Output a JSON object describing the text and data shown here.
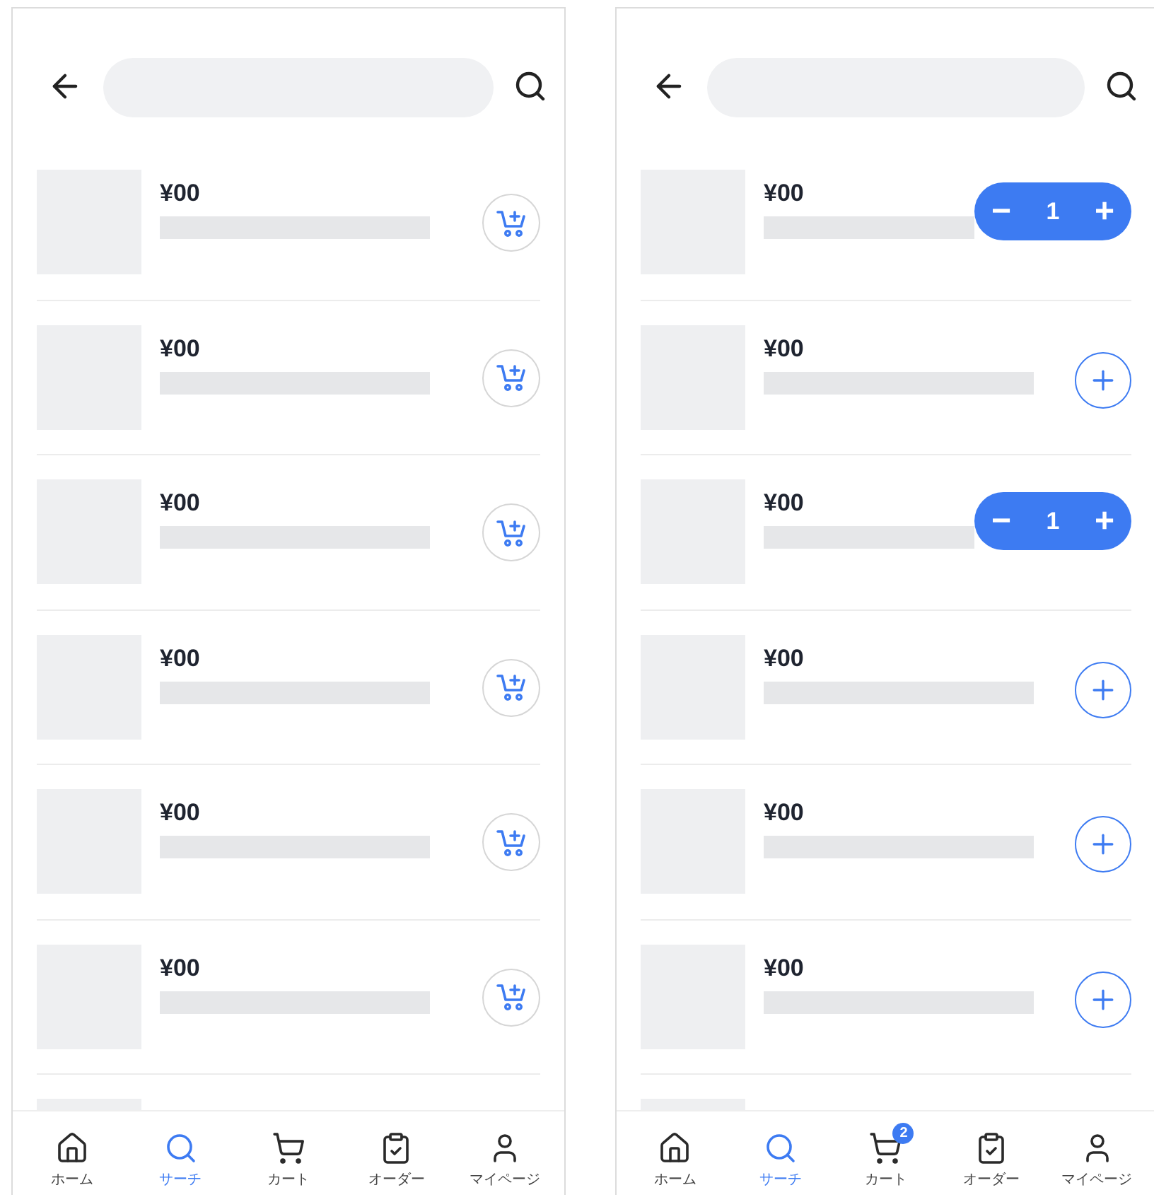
{
  "screens": [
    {
      "rows": [
        {
          "price": "¥00",
          "kind": "cart"
        },
        {
          "price": "¥00",
          "kind": "cart"
        },
        {
          "price": "¥00",
          "kind": "cart"
        },
        {
          "price": "¥00",
          "kind": "cart"
        },
        {
          "price": "¥00",
          "kind": "cart"
        },
        {
          "price": "¥00",
          "kind": "cart"
        }
      ],
      "nav": [
        {
          "label": "ホーム",
          "kind": "home",
          "selected": false
        },
        {
          "label": "サーチ",
          "kind": "search",
          "selected": true
        },
        {
          "label": "カート",
          "kind": "cart",
          "selected": false
        },
        {
          "label": "オーダー",
          "kind": "order",
          "selected": false
        },
        {
          "label": "マイページ",
          "kind": "user",
          "selected": false
        }
      ]
    },
    {
      "rows": [
        {
          "price": "¥00",
          "kind": "stepper",
          "quantity": "1",
          "minus": "−",
          "plus": "+"
        },
        {
          "price": "¥00",
          "kind": "add"
        },
        {
          "price": "¥00",
          "kind": "stepper",
          "quantity": "1",
          "minus": "−",
          "plus": "+"
        },
        {
          "price": "¥00",
          "kind": "add"
        },
        {
          "price": "¥00",
          "kind": "add"
        },
        {
          "price": "¥00",
          "kind": "add"
        }
      ],
      "nav": [
        {
          "label": "ホーム",
          "kind": "home",
          "selected": false
        },
        {
          "label": "サーチ",
          "kind": "search",
          "selected": true
        },
        {
          "label": "カート",
          "kind": "cart",
          "selected": false,
          "badge": "2"
        },
        {
          "label": "オーダー",
          "kind": "order",
          "selected": false
        },
        {
          "label": "マイページ",
          "kind": "user",
          "selected": false
        }
      ]
    }
  ]
}
